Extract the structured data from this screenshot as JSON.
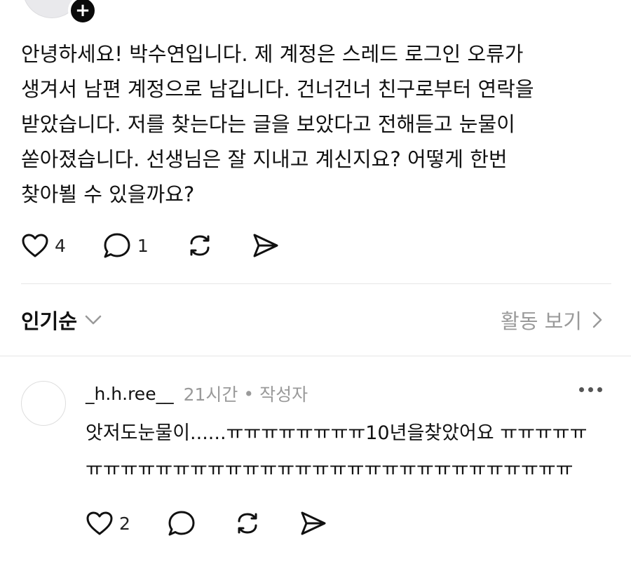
{
  "post": {
    "avatar_icon": "profile-avatar",
    "follow_icon": "plus-icon",
    "lines": [
      "안녕하세요! 박수연입니다. 제 계정은 스레드 로그인 오류가",
      "생겨서 남편 계정으로 남깁니다. 건너건너 친구로부터 연락을",
      "받았습니다. 저를 찾는다는 글을 보았다고 전해듣고 눈물이",
      "쏟아졌습니다. 선생님은 잘 지내고 계신지요? 어떻게 한번",
      "찾아뵐 수 있을까요?"
    ],
    "like_count": "4",
    "reply_count": "1"
  },
  "sort": {
    "label": "인기순",
    "activity_label": "활동 보기"
  },
  "comment": {
    "username": "_h.h.ree__",
    "time": "21시간",
    "dot": "•",
    "badge": "작성자",
    "lines": [
      "앗저도눈물이......ㅠㅠㅠㅠㅠㅠㅠㅠ10년을찾았어요 ㅠㅠㅠㅠㅠ",
      "ㅠㅠㅠㅠㅠㅠㅠㅠㅠㅠㅠㅠㅠㅠㅠㅠㅠㅠㅠㅠㅠㅠㅠㅠㅠㅠㅠㅠ"
    ],
    "like_count": "2"
  },
  "colors": {
    "text": "#111111",
    "muted": "#9a9a9a",
    "divider": "#e6e6e6"
  }
}
